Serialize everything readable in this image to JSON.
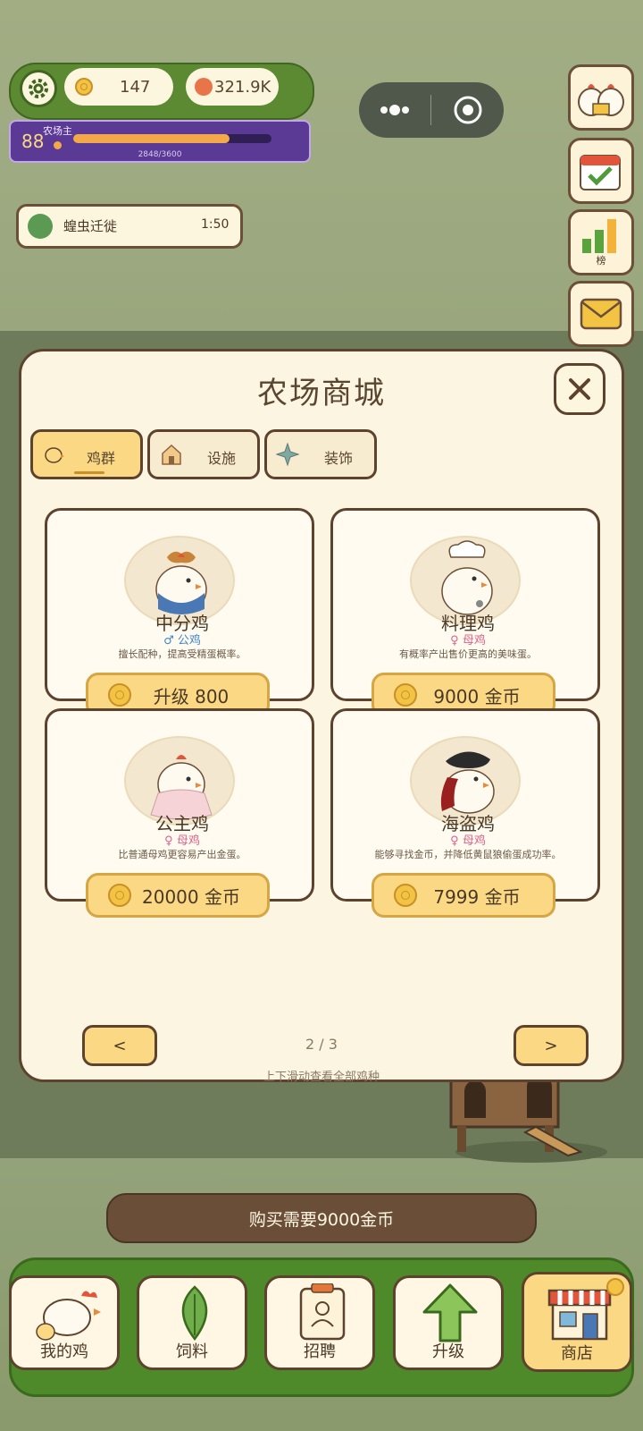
{
  "status": {
    "coins": "147",
    "gems": "321.9K"
  },
  "level": {
    "number": "88",
    "title": "农场主",
    "xp": "2848/3600",
    "progress": 0.79
  },
  "event": {
    "name": "蝗虫迁徙",
    "timer": "1:50"
  },
  "side": {
    "rank_label": "榜"
  },
  "shop": {
    "title": "农场商城",
    "tabs": [
      {
        "label": "鸡群"
      },
      {
        "label": "设施"
      },
      {
        "label": "装饰"
      }
    ],
    "cards": [
      {
        "name": "中分鸡",
        "gender": "♂ 公鸡",
        "desc": "擅长配种，提高受精蛋概率。",
        "price": "升级 800"
      },
      {
        "name": "料理鸡",
        "gender": "♀ 母鸡",
        "desc": "有概率产出售价更高的美味蛋。",
        "price": "9000 金币"
      },
      {
        "name": "公主鸡",
        "gender": "♀ 母鸡",
        "desc": "比普通母鸡更容易产出金蛋。",
        "price": "20000 金币"
      },
      {
        "name": "海盗鸡",
        "gender": "♀ 母鸡",
        "desc": "能够寻找金币，并降低黄鼠狼偷蛋成功率。",
        "price": "7999 金币"
      }
    ],
    "prev": "<",
    "next": ">",
    "page": "2 / 3",
    "hint": "上下滑动查看全部鸡种"
  },
  "buy_bar": "购买需要9000金币",
  "dock": [
    {
      "label": "我的鸡"
    },
    {
      "label": "饲料"
    },
    {
      "label": "招聘"
    },
    {
      "label": "升级"
    },
    {
      "label": "商店"
    }
  ],
  "colors": {
    "accent": "#fbd884",
    "brown": "#5d432e",
    "male": "#3f86c9",
    "female": "#e0608a"
  }
}
